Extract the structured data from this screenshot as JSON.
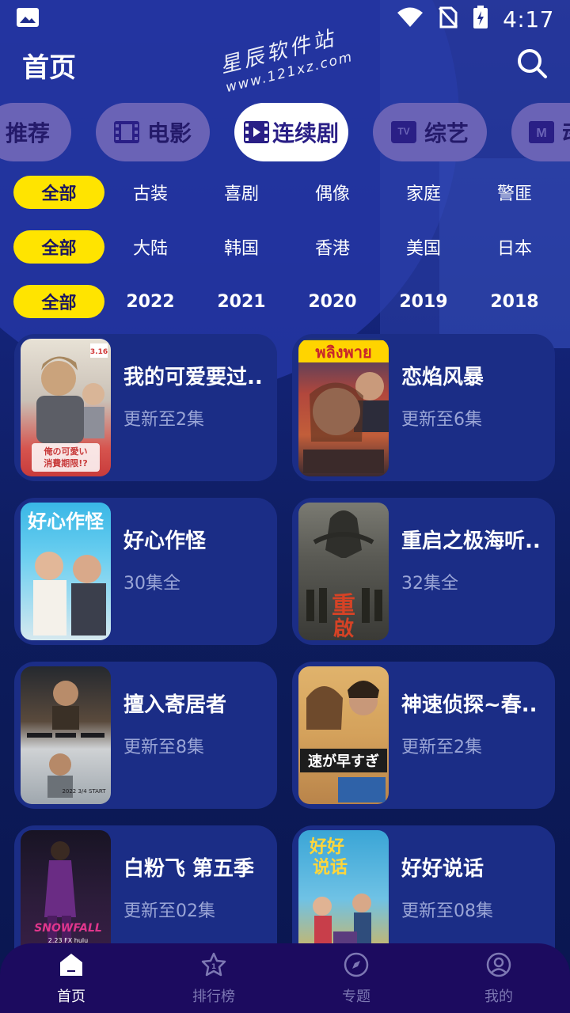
{
  "status": {
    "time": "4:17"
  },
  "header": {
    "title": "首页"
  },
  "watermark": {
    "line1": "星辰软件站",
    "line2": "www.121xz.com"
  },
  "channels": [
    {
      "label": "推荐",
      "icon": "none",
      "active": false
    },
    {
      "label": "电影",
      "icon": "film-icon",
      "active": false
    },
    {
      "label": "连续剧",
      "icon": "play-film-icon",
      "active": true
    },
    {
      "label": "综艺",
      "icon": "tv-icon",
      "active": false
    },
    {
      "label": "动漫",
      "icon": "m-icon",
      "active": false
    }
  ],
  "filters": {
    "genre": {
      "selected": "全部",
      "items": [
        "古装",
        "喜剧",
        "偶像",
        "家庭",
        "警匪"
      ]
    },
    "region": {
      "selected": "全部",
      "items": [
        "大陆",
        "韩国",
        "香港",
        "美国",
        "日本"
      ]
    },
    "year": {
      "selected": "全部",
      "items": [
        "2022",
        "2021",
        "2020",
        "2019",
        "2018"
      ]
    }
  },
  "shows": [
    {
      "title": "我的可爱要过..",
      "sub": "更新至2集"
    },
    {
      "title": "恋焰风暴",
      "sub": "更新至6集"
    },
    {
      "title": "好心作怪",
      "sub": "30集全"
    },
    {
      "title": "重启之极海听..",
      "sub": "32集全"
    },
    {
      "title": "擅入寄居者",
      "sub": "更新至8集"
    },
    {
      "title": "神速侦探~春..",
      "sub": "更新至2集"
    },
    {
      "title": "白粉飞 第五季",
      "sub": "更新至02集"
    },
    {
      "title": "好好说话",
      "sub": "更新至08集"
    }
  ],
  "posters": [
    {
      "lines": [
        "3.16",
        "俺の可愛い",
        "消費期限!?"
      ]
    },
    {
      "lines": [
        "พลิงพาย"
      ]
    },
    {
      "lines": [
        "好心作怪"
      ]
    },
    {
      "lines": [
        "重",
        "啟"
      ]
    },
    {
      "lines": [
        "2022 3/4 START"
      ]
    },
    {
      "lines": [
        "速が早すぎ"
      ]
    },
    {
      "lines": [
        "SNOWFALL",
        "2.23 FX  hulu"
      ]
    },
    {
      "lines": [
        "好好",
        "说话"
      ]
    }
  ],
  "nav": [
    {
      "label": "首页",
      "icon": "home-icon",
      "active": true
    },
    {
      "label": "排行榜",
      "icon": "star-ranking-icon",
      "active": false
    },
    {
      "label": "专题",
      "icon": "compass-icon",
      "active": false
    },
    {
      "label": "我的",
      "icon": "user-icon",
      "active": false
    }
  ],
  "colors": {
    "accent_yellow": "#ffe400",
    "card_bg": "#1b2d86",
    "nav_bg": "#1c0b5f",
    "tab_bg": "#6a63b6"
  }
}
